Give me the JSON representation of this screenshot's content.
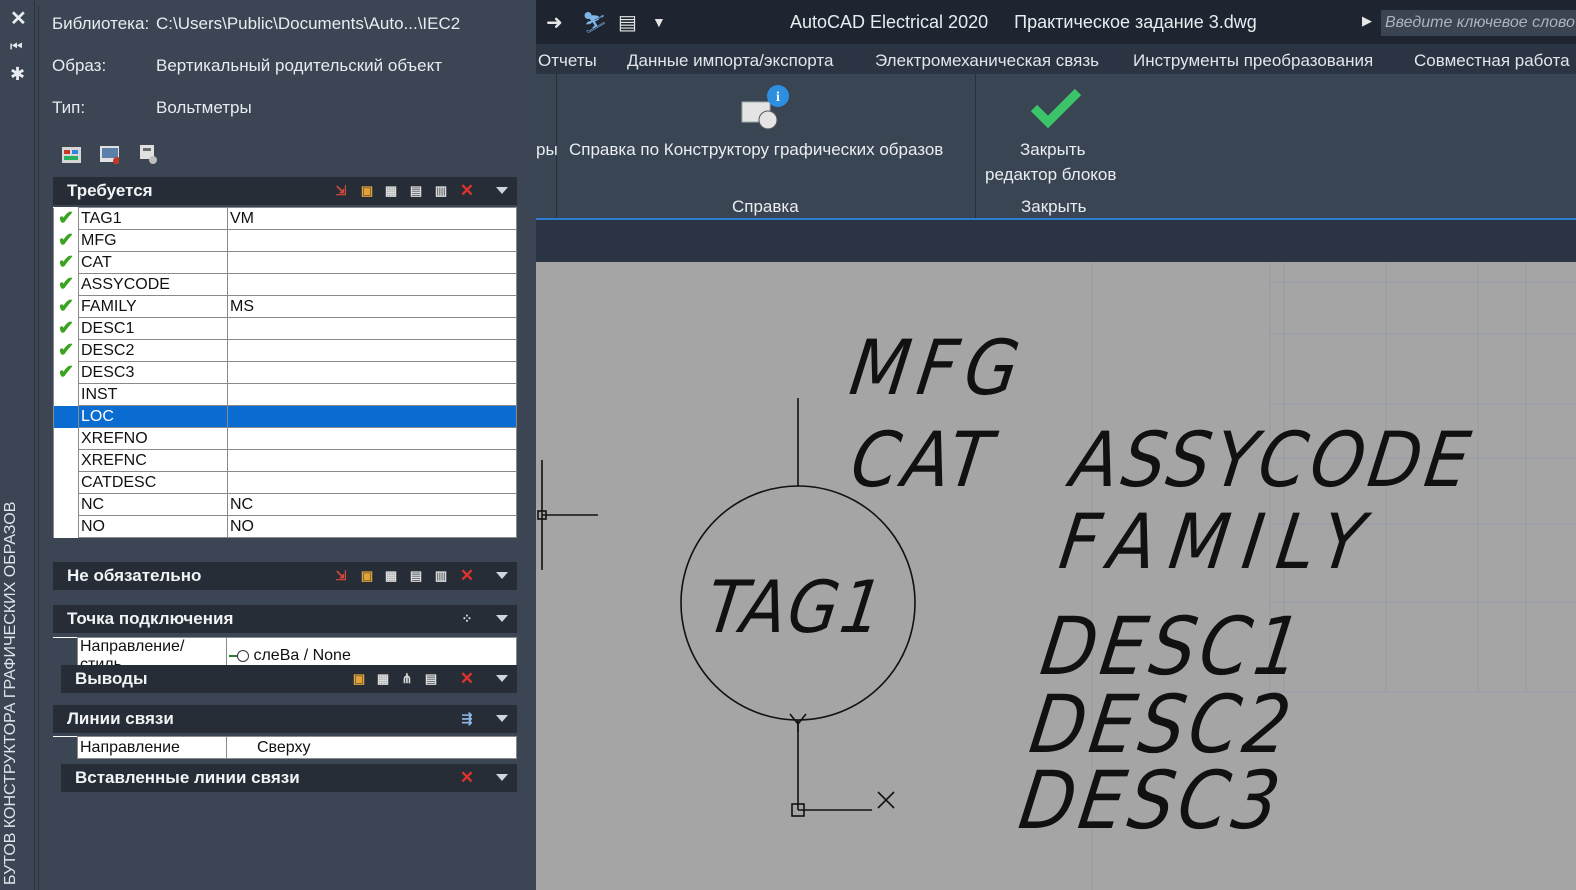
{
  "window": {
    "app_title": "AutoCAD Electrical 2020",
    "doc_title": "Практическое задание 3.dwg",
    "search_placeholder": "Введите ключевое слово"
  },
  "ribbon": {
    "tabs": [
      "Отчеты",
      "Данные импорта/экспорта",
      "Электромеханическая связь",
      "Инструменты преобразования",
      "Совместная работа"
    ],
    "cut_text": "ры",
    "help_button": "Справка по Конструктору графических образов",
    "help_group": "Справка",
    "close_button_line1": "Закрыть",
    "close_button_line2": "редактор блоков",
    "close_group": "Закрыть"
  },
  "palette": {
    "vertical_title": "БУТОВ КОНСТРУКТОРА ГРАФИЧЕСКИХ ОБРАЗОВ",
    "library_label": "Библиотека:",
    "library_value": "C:\\Users\\Public\\Documents\\Auto...\\IEC2",
    "image_label": "Образ:",
    "image_value": "Вертикальный родительский объект",
    "type_label": "Тип:",
    "type_value": "Вольтметры",
    "required": {
      "title": "Требуется",
      "rows": [
        {
          "name": "TAG1",
          "value": "VM",
          "checked": true
        },
        {
          "name": "MFG",
          "value": "",
          "checked": true
        },
        {
          "name": "CAT",
          "value": "",
          "checked": true
        },
        {
          "name": "ASSYCODE",
          "value": "",
          "checked": true
        },
        {
          "name": "FAMILY",
          "value": "MS",
          "checked": true
        },
        {
          "name": "DESC1",
          "value": "",
          "checked": true
        },
        {
          "name": "DESC2",
          "value": "",
          "checked": true
        },
        {
          "name": "DESC3",
          "value": "",
          "checked": true
        },
        {
          "name": "INST",
          "value": "",
          "checked": false
        },
        {
          "name": "LOC",
          "value": "",
          "checked": false,
          "selected": true
        },
        {
          "name": "XREFNO",
          "value": "",
          "checked": false
        },
        {
          "name": "XREFNC",
          "value": "",
          "checked": false
        },
        {
          "name": "CATDESC",
          "value": "",
          "checked": false
        },
        {
          "name": "NC",
          "value": "NC",
          "checked": false
        },
        {
          "name": "NO",
          "value": "NO",
          "checked": false
        }
      ]
    },
    "optional_title": "Не обязательно",
    "connection": {
      "title": "Точка подключения",
      "direction_label": "Направление/стиль",
      "direction_value": "слеВа / None"
    },
    "pins_title": "Выводы",
    "wires": {
      "title": "Линии связи",
      "direction_label": "Направление",
      "direction_value": "Сверху"
    },
    "inserted_wires_title": "Вставленные линии связи"
  },
  "drawing": {
    "labels": [
      "MFG",
      "CAT",
      "ASSYCODE",
      "FAMILY",
      "TAG1",
      "DESC1",
      "DESC2",
      "DESC3"
    ]
  },
  "colors": {
    "selection": "#0a6cd0",
    "check": "#3aa320",
    "delete": "#e0322c",
    "accent_blue": "#2a7ed1",
    "canvas": "#a5a5a5"
  }
}
